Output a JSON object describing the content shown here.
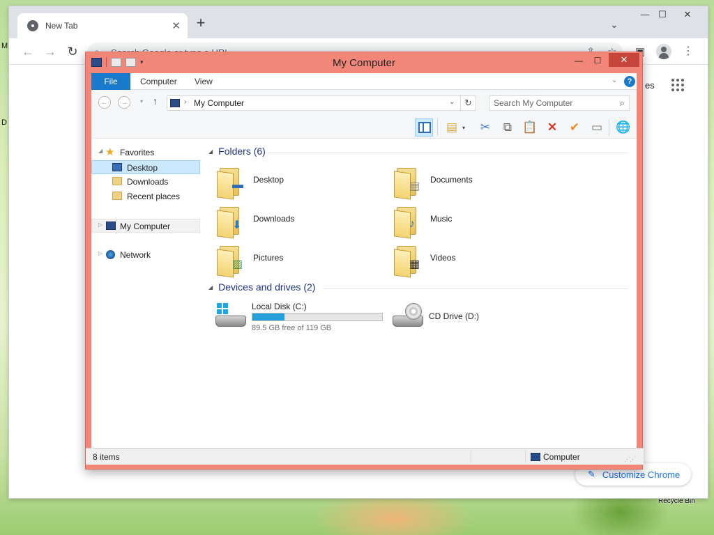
{
  "desktop": {
    "left_edge_letters": [
      "M",
      "D"
    ],
    "recycle_bin_label": "Recycle Bin"
  },
  "chrome": {
    "tab_title": "New Tab",
    "tab_close": "✕",
    "new_tab": "+",
    "minimize": "—",
    "maximize": "☐",
    "close": "✕",
    "tab_search": "⌄",
    "back": "←",
    "forward": "→",
    "reload": "↻",
    "omnibox_placeholder": "Search Google or type a URL",
    "share": "⇪",
    "bookmark": "☆",
    "side_panel": "▣",
    "menu": "⋮",
    "ntp_partial_text": "es",
    "customize_label": "Customize Chrome",
    "pencil_glyph": "✎",
    "accent": "#1a73e8"
  },
  "explorer": {
    "title": "My Computer",
    "minimize": "—",
    "maximize": "☐",
    "close": "✕",
    "ribbon": {
      "tabs": [
        "File",
        "Computer",
        "View"
      ],
      "collapse_glyph": "⌄",
      "help_glyph": "?",
      "file_tab_color": "#1979ca"
    },
    "address": {
      "back": "←",
      "forward": "→",
      "history": "▾",
      "up": "↑",
      "separator": "›",
      "path": "My Computer",
      "dropdown": "⌄",
      "refresh": "↻",
      "search_placeholder": "Search My Computer",
      "search_glyph": "⌕"
    },
    "commands": {
      "drop": "▾",
      "cut": "✂",
      "copy": "⧉",
      "paste": "📋",
      "delete": "✕",
      "ok": "✔",
      "rename": "▭",
      "globe": "🌐"
    },
    "nav": {
      "expand_glyph": "◢",
      "collapsed_glyph": "▷",
      "favorites": "Favorites",
      "favorites_items": [
        "Desktop",
        "Downloads",
        "Recent places"
      ],
      "computer": "My Computer",
      "network": "Network"
    },
    "groups": {
      "caret": "◢",
      "folders_header": "Folders (6)",
      "devices_header": "Devices and drives (2)"
    },
    "folders": [
      {
        "name": "Desktop",
        "badge": "▬",
        "badge_color": "#2a6ebd"
      },
      {
        "name": "Documents",
        "badge": "▤",
        "badge_color": "#8a8a8a"
      },
      {
        "name": "Downloads",
        "badge": "⬇",
        "badge_color": "#1e7fd0"
      },
      {
        "name": "Music",
        "badge": "♪",
        "badge_color": "#1e7fd0"
      },
      {
        "name": "Pictures",
        "badge": "▨",
        "badge_color": "#4a9a5a"
      },
      {
        "name": "Videos",
        "badge": "▦",
        "badge_color": "#333333"
      }
    ],
    "drives": [
      {
        "name": "Local Disk (C:)",
        "used_fraction": 0.248,
        "free_text": "89.5 GB free of 119 GB"
      },
      {
        "name": "CD Drive (D:)"
      }
    ],
    "status": {
      "items_count": "8 items",
      "bar_count": "8 items",
      "location": "Computer",
      "grip": "⋰⋰"
    },
    "frame_color": "#f28679"
  }
}
